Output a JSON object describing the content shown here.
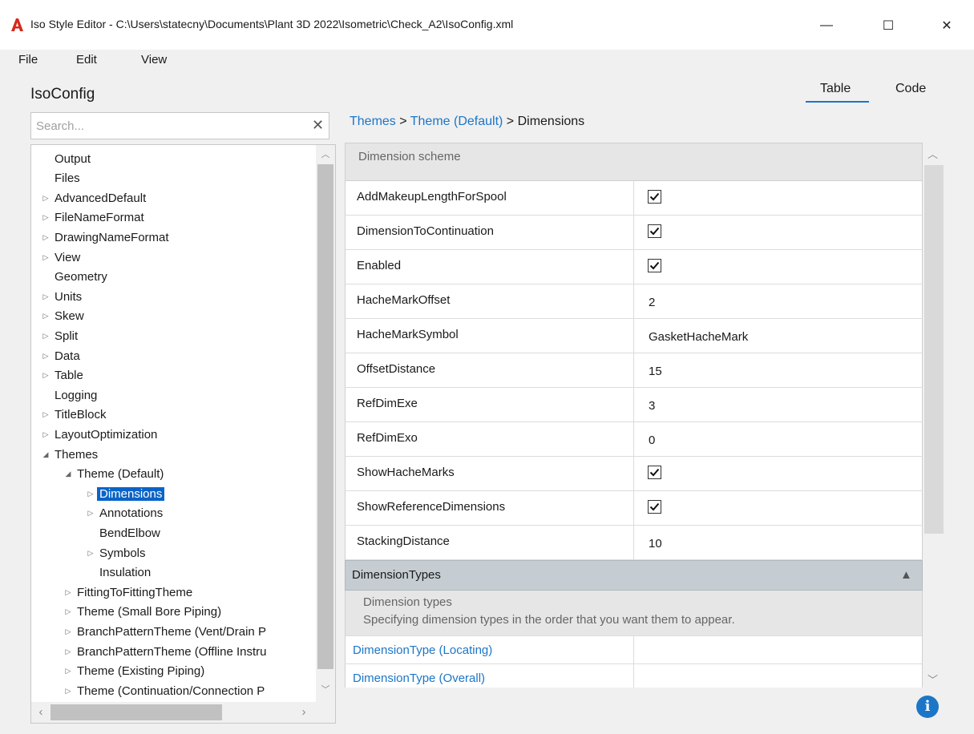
{
  "window": {
    "title": "Iso Style Editor - C:\\Users\\statecny\\Documents\\Plant 3D 2022\\Isometric\\Check_A2\\IsoConfig.xml",
    "minimize": "—",
    "maximize": "☐",
    "close": "✕"
  },
  "menu": {
    "file": "File",
    "edit": "Edit",
    "view": "View"
  },
  "header": {
    "title": "IsoConfig",
    "tab_table": "Table",
    "tab_code": "Code"
  },
  "search": {
    "placeholder": "Search...",
    "clear": "✕"
  },
  "tree": {
    "items": [
      {
        "label": "Output",
        "expand": ""
      },
      {
        "label": "Files",
        "expand": ""
      },
      {
        "label": "AdvancedDefault",
        "expand": "collapsed"
      },
      {
        "label": "FileNameFormat",
        "expand": "collapsed"
      },
      {
        "label": "DrawingNameFormat",
        "expand": "collapsed"
      },
      {
        "label": "View",
        "expand": "collapsed"
      },
      {
        "label": "Geometry",
        "expand": ""
      },
      {
        "label": "Units",
        "expand": "collapsed"
      },
      {
        "label": "Skew",
        "expand": "collapsed"
      },
      {
        "label": "Split",
        "expand": "collapsed"
      },
      {
        "label": "Data",
        "expand": "collapsed"
      },
      {
        "label": "Table",
        "expand": "collapsed"
      },
      {
        "label": "Logging",
        "expand": ""
      },
      {
        "label": "TitleBlock",
        "expand": "collapsed"
      },
      {
        "label": "LayoutOptimization",
        "expand": "collapsed"
      },
      {
        "label": "Themes",
        "expand": "expanded"
      },
      {
        "label": "Theme (Default)",
        "expand": "expanded"
      },
      {
        "label": "Dimensions",
        "expand": "collapsed"
      },
      {
        "label": "Annotations",
        "expand": "collapsed"
      },
      {
        "label": "BendElbow",
        "expand": ""
      },
      {
        "label": "Symbols",
        "expand": "collapsed"
      },
      {
        "label": "Insulation",
        "expand": ""
      },
      {
        "label": "FittingToFittingTheme",
        "expand": "collapsed"
      },
      {
        "label": "Theme (Small Bore Piping)",
        "expand": "collapsed"
      },
      {
        "label": "BranchPatternTheme (Vent/Drain P",
        "expand": "collapsed"
      },
      {
        "label": "BranchPatternTheme (Offline Instru",
        "expand": "collapsed"
      },
      {
        "label": "Theme (Existing Piping)",
        "expand": "collapsed"
      },
      {
        "label": "Theme (Continuation/Connection P",
        "expand": "collapsed"
      }
    ],
    "selected": "Dimensions"
  },
  "breadcrumb": {
    "part1": "Themes",
    "sep1": " > ",
    "part2": "Theme (Default)",
    "sep2": " > ",
    "part3": "Dimensions"
  },
  "properties": {
    "section_header": "Dimension scheme",
    "rows": [
      {
        "name": "AddMakeupLengthForSpool",
        "type": "check",
        "value": true
      },
      {
        "name": "DimensionToContinuation",
        "type": "check",
        "value": true
      },
      {
        "name": "Enabled",
        "type": "check",
        "value": true
      },
      {
        "name": "HacheMarkOffset",
        "type": "text",
        "value": "2"
      },
      {
        "name": "HacheMarkSymbol",
        "type": "text",
        "value": "GasketHacheMark"
      },
      {
        "name": "OffsetDistance",
        "type": "text",
        "value": "15"
      },
      {
        "name": "RefDimExe",
        "type": "text",
        "value": "3"
      },
      {
        "name": "RefDimExo",
        "type": "text",
        "value": "0"
      },
      {
        "name": "ShowHacheMarks",
        "type": "check",
        "value": true
      },
      {
        "name": "ShowReferenceDimensions",
        "type": "check",
        "value": true
      },
      {
        "name": "StackingDistance",
        "type": "text",
        "value": "10"
      }
    ]
  },
  "dimension_types": {
    "header": "DimensionTypes",
    "desc_title": "Dimension types",
    "desc_text": "Specifying dimension types in the order that you want them to appear.",
    "items": [
      "DimensionType (Locating)",
      "DimensionType (Overall)"
    ]
  },
  "colors": {
    "accent": "#1c76c7",
    "selection": "#0a64c8",
    "section_bg": "#c5cdd3"
  },
  "icons": {
    "info": "i"
  }
}
